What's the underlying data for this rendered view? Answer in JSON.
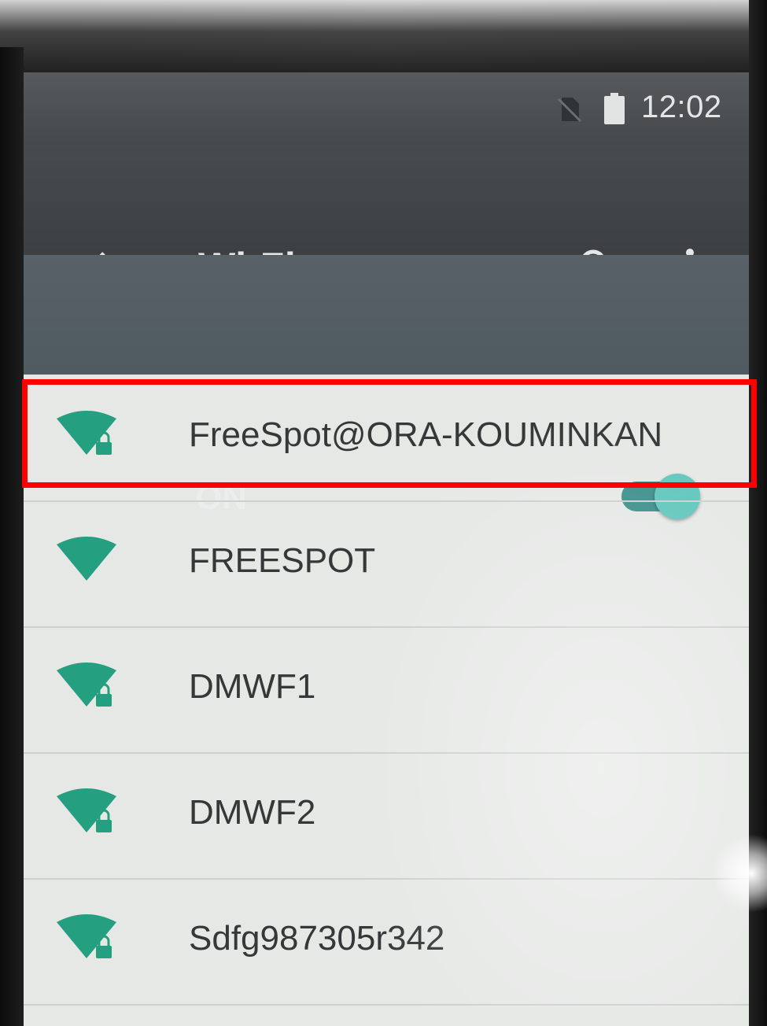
{
  "status_bar": {
    "time": "12:02",
    "icons": [
      "no-sim-icon",
      "battery-icon"
    ]
  },
  "app_bar": {
    "title": "Wi-Fi",
    "icons": [
      "back-arrow-icon",
      "search-icon",
      "more-vert-icon"
    ]
  },
  "master_switch": {
    "label": "ON",
    "state": "on"
  },
  "networks": [
    {
      "ssid": "FreeSpot@ORA-KOUMINKAN",
      "secured": true,
      "highlighted": true
    },
    {
      "ssid": "FREESPOT",
      "secured": false
    },
    {
      "ssid": "DMWF1",
      "secured": true
    },
    {
      "ssid": "DMWF2",
      "secured": true
    },
    {
      "ssid": "Sdfg987305r342",
      "secured": true
    }
  ],
  "colors": {
    "accent": "#5fc6bc",
    "wifi_icon": "#24a081",
    "highlight": "#ff0000",
    "app_bar": "#3c4043",
    "switch_bar": "#4f5a61"
  }
}
